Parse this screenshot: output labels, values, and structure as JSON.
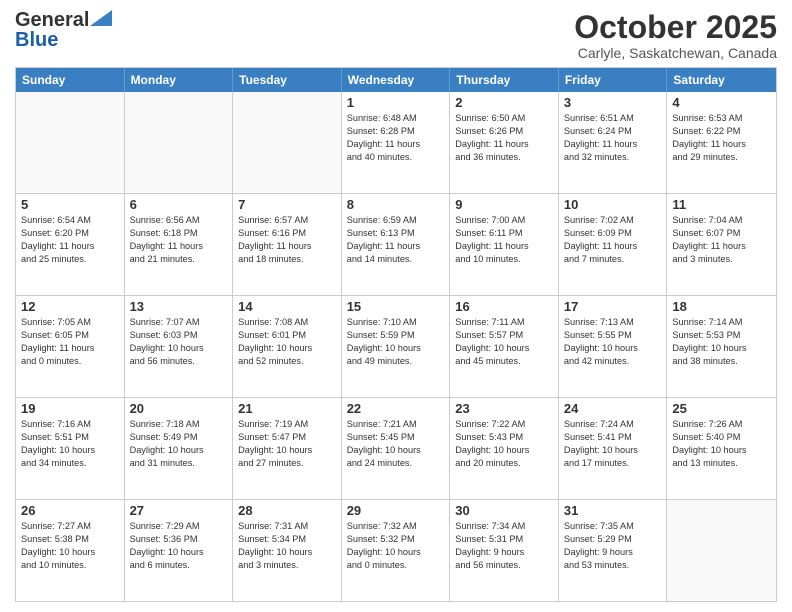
{
  "logo": {
    "general": "General",
    "blue": "Blue"
  },
  "header": {
    "month": "October 2025",
    "location": "Carlyle, Saskatchewan, Canada"
  },
  "weekdays": [
    "Sunday",
    "Monday",
    "Tuesday",
    "Wednesday",
    "Thursday",
    "Friday",
    "Saturday"
  ],
  "rows": [
    [
      {
        "day": "",
        "info": ""
      },
      {
        "day": "",
        "info": ""
      },
      {
        "day": "",
        "info": ""
      },
      {
        "day": "1",
        "info": "Sunrise: 6:48 AM\nSunset: 6:28 PM\nDaylight: 11 hours\nand 40 minutes."
      },
      {
        "day": "2",
        "info": "Sunrise: 6:50 AM\nSunset: 6:26 PM\nDaylight: 11 hours\nand 36 minutes."
      },
      {
        "day": "3",
        "info": "Sunrise: 6:51 AM\nSunset: 6:24 PM\nDaylight: 11 hours\nand 32 minutes."
      },
      {
        "day": "4",
        "info": "Sunrise: 6:53 AM\nSunset: 6:22 PM\nDaylight: 11 hours\nand 29 minutes."
      }
    ],
    [
      {
        "day": "5",
        "info": "Sunrise: 6:54 AM\nSunset: 6:20 PM\nDaylight: 11 hours\nand 25 minutes."
      },
      {
        "day": "6",
        "info": "Sunrise: 6:56 AM\nSunset: 6:18 PM\nDaylight: 11 hours\nand 21 minutes."
      },
      {
        "day": "7",
        "info": "Sunrise: 6:57 AM\nSunset: 6:16 PM\nDaylight: 11 hours\nand 18 minutes."
      },
      {
        "day": "8",
        "info": "Sunrise: 6:59 AM\nSunset: 6:13 PM\nDaylight: 11 hours\nand 14 minutes."
      },
      {
        "day": "9",
        "info": "Sunrise: 7:00 AM\nSunset: 6:11 PM\nDaylight: 11 hours\nand 10 minutes."
      },
      {
        "day": "10",
        "info": "Sunrise: 7:02 AM\nSunset: 6:09 PM\nDaylight: 11 hours\nand 7 minutes."
      },
      {
        "day": "11",
        "info": "Sunrise: 7:04 AM\nSunset: 6:07 PM\nDaylight: 11 hours\nand 3 minutes."
      }
    ],
    [
      {
        "day": "12",
        "info": "Sunrise: 7:05 AM\nSunset: 6:05 PM\nDaylight: 11 hours\nand 0 minutes."
      },
      {
        "day": "13",
        "info": "Sunrise: 7:07 AM\nSunset: 6:03 PM\nDaylight: 10 hours\nand 56 minutes."
      },
      {
        "day": "14",
        "info": "Sunrise: 7:08 AM\nSunset: 6:01 PM\nDaylight: 10 hours\nand 52 minutes."
      },
      {
        "day": "15",
        "info": "Sunrise: 7:10 AM\nSunset: 5:59 PM\nDaylight: 10 hours\nand 49 minutes."
      },
      {
        "day": "16",
        "info": "Sunrise: 7:11 AM\nSunset: 5:57 PM\nDaylight: 10 hours\nand 45 minutes."
      },
      {
        "day": "17",
        "info": "Sunrise: 7:13 AM\nSunset: 5:55 PM\nDaylight: 10 hours\nand 42 minutes."
      },
      {
        "day": "18",
        "info": "Sunrise: 7:14 AM\nSunset: 5:53 PM\nDaylight: 10 hours\nand 38 minutes."
      }
    ],
    [
      {
        "day": "19",
        "info": "Sunrise: 7:16 AM\nSunset: 5:51 PM\nDaylight: 10 hours\nand 34 minutes."
      },
      {
        "day": "20",
        "info": "Sunrise: 7:18 AM\nSunset: 5:49 PM\nDaylight: 10 hours\nand 31 minutes."
      },
      {
        "day": "21",
        "info": "Sunrise: 7:19 AM\nSunset: 5:47 PM\nDaylight: 10 hours\nand 27 minutes."
      },
      {
        "day": "22",
        "info": "Sunrise: 7:21 AM\nSunset: 5:45 PM\nDaylight: 10 hours\nand 24 minutes."
      },
      {
        "day": "23",
        "info": "Sunrise: 7:22 AM\nSunset: 5:43 PM\nDaylight: 10 hours\nand 20 minutes."
      },
      {
        "day": "24",
        "info": "Sunrise: 7:24 AM\nSunset: 5:41 PM\nDaylight: 10 hours\nand 17 minutes."
      },
      {
        "day": "25",
        "info": "Sunrise: 7:26 AM\nSunset: 5:40 PM\nDaylight: 10 hours\nand 13 minutes."
      }
    ],
    [
      {
        "day": "26",
        "info": "Sunrise: 7:27 AM\nSunset: 5:38 PM\nDaylight: 10 hours\nand 10 minutes."
      },
      {
        "day": "27",
        "info": "Sunrise: 7:29 AM\nSunset: 5:36 PM\nDaylight: 10 hours\nand 6 minutes."
      },
      {
        "day": "28",
        "info": "Sunrise: 7:31 AM\nSunset: 5:34 PM\nDaylight: 10 hours\nand 3 minutes."
      },
      {
        "day": "29",
        "info": "Sunrise: 7:32 AM\nSunset: 5:32 PM\nDaylight: 10 hours\nand 0 minutes."
      },
      {
        "day": "30",
        "info": "Sunrise: 7:34 AM\nSunset: 5:31 PM\nDaylight: 9 hours\nand 56 minutes."
      },
      {
        "day": "31",
        "info": "Sunrise: 7:35 AM\nSunset: 5:29 PM\nDaylight: 9 hours\nand 53 minutes."
      },
      {
        "day": "",
        "info": ""
      }
    ]
  ]
}
